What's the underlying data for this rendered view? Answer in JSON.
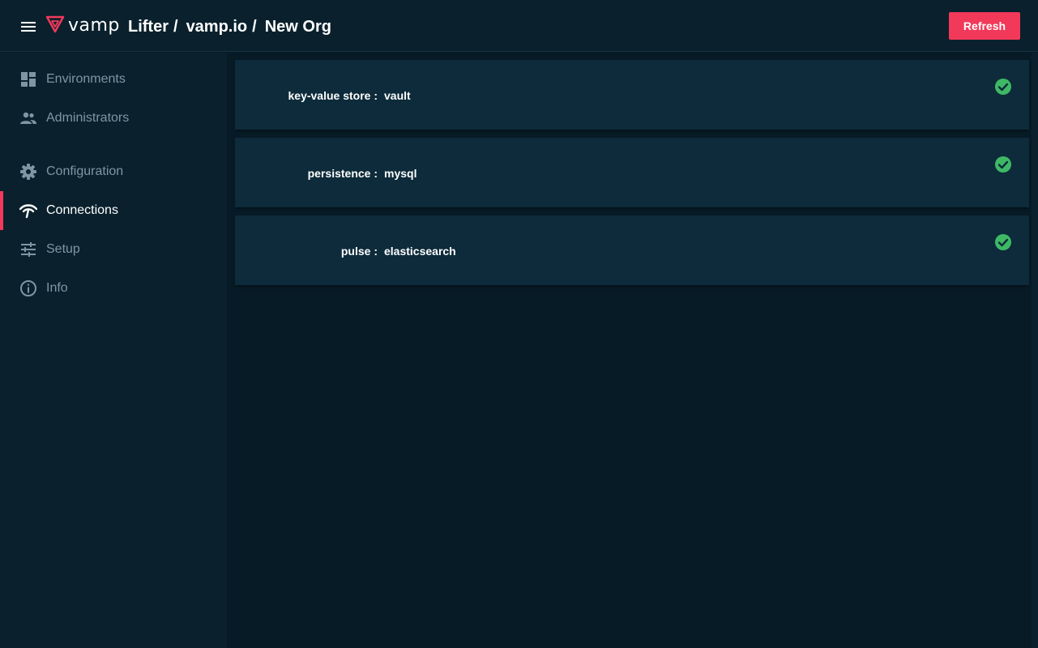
{
  "header": {
    "menu_icon": "hamburger-icon",
    "logo_icon": "vamp-logo-icon",
    "logo_text": "vamp",
    "breadcrumb": [
      "Lifter",
      "vamp.io",
      "New Org"
    ],
    "separator": "/",
    "refresh_label": "Refresh"
  },
  "sidebar": {
    "items": [
      {
        "label": "Environments",
        "icon": "dashboard-icon"
      },
      {
        "label": "Administrators",
        "icon": "people-icon"
      },
      {
        "label": "Configuration",
        "icon": "gear-icon"
      },
      {
        "label": "Connections",
        "icon": "wifi-signal-icon",
        "active": true
      },
      {
        "label": "Setup",
        "icon": "sliders-icon"
      },
      {
        "label": "Info",
        "icon": "info-icon"
      }
    ]
  },
  "connections": [
    {
      "key": "key-value store :",
      "value": "vault",
      "status": "ok"
    },
    {
      "key": "persistence :",
      "value": "mysql",
      "status": "ok"
    },
    {
      "key": "pulse :",
      "value": "elasticsearch",
      "status": "ok"
    }
  ],
  "colors": {
    "accent": "#f2395a",
    "status_ok": "#3fb866",
    "sidebar_bg": "#0a212d",
    "card_bg": "#0d2b3a",
    "page_bg": "#071b26"
  }
}
